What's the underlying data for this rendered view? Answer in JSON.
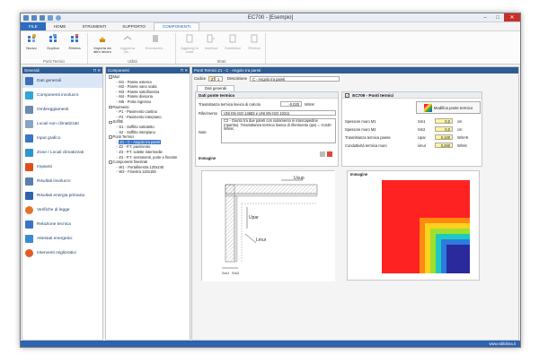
{
  "window": {
    "title": "EC700 - [Esempio]"
  },
  "menu_tabs": [
    {
      "label": "FILE"
    },
    {
      "label": "HOME"
    },
    {
      "label": "STRUMENTI"
    },
    {
      "label": "SUPPORTO"
    },
    {
      "label": "COMPONENTI"
    }
  ],
  "ribbon": {
    "group1_label": "Ponti Termici",
    "group2_label": "Utilità",
    "group3_label": "Strati",
    "buttons": {
      "nuovo": "Nuovo",
      "duplica": "Duplica",
      "elimina": "Elimina",
      "importa": "Importa da altro lavoro",
      "aggiorna": "Aggiorna da...",
      "sovrascrivi": "Sovrascrivi...",
      "aggiungi": "Aggiungi in coda",
      "inserisci": "Inserisci",
      "sostituisci": "Sostituisci",
      "elimina_strato": "Elimina"
    }
  },
  "generali_panel": {
    "title": "Generali",
    "items": [
      {
        "label": "Dati generali"
      },
      {
        "label": "Componenti involucro"
      },
      {
        "label": "Ombreggiamenti"
      },
      {
        "label": "Locali non climatizzati"
      },
      {
        "label": "Input grafico"
      },
      {
        "label": "Zone / Locali climatizzati"
      },
      {
        "label": "Impianti"
      },
      {
        "label": "Risultati involucro"
      },
      {
        "label": "Risultati energia primaria"
      },
      {
        "label": "Verifiche di legge"
      },
      {
        "label": "Relazione tecnica"
      },
      {
        "label": "Attestati energetici"
      },
      {
        "label": "Interventi migliorativi"
      }
    ]
  },
  "componenti_panel": {
    "title": "Componenti",
    "tree": [
      {
        "level": 1,
        "label": "Muri"
      },
      {
        "level": 2,
        "label": "M1 - Parete esterna"
      },
      {
        "level": 2,
        "label": "M2 - Parete vano scala"
      },
      {
        "level": 2,
        "label": "M3 - Parete sottofinestra"
      },
      {
        "level": 2,
        "label": "M4 - Parete divisoria"
      },
      {
        "level": 2,
        "label": "M5 - Porta ingresso"
      },
      {
        "level": 1,
        "label": "Pavimenti"
      },
      {
        "level": 2,
        "label": "P1 - Pavimento cantina"
      },
      {
        "level": 2,
        "label": "P2 - Pavimento interpiano"
      },
      {
        "level": 1,
        "label": "Soffitti"
      },
      {
        "level": 2,
        "label": "S1 - Soffitto sottotetto"
      },
      {
        "level": 2,
        "label": "S2 - Soffitto interpiano"
      },
      {
        "level": 1,
        "label": "Ponti Termici"
      },
      {
        "level": 2,
        "label": "Z1 - C - Angolo tra pareti",
        "selected": true
      },
      {
        "level": 2,
        "label": "Z2 - P.T. pavimento"
      },
      {
        "level": 2,
        "label": "Z3 - P.T. solette intermedie"
      },
      {
        "level": 2,
        "label": "Z4 - P.T. serramenti, porte e finestre"
      },
      {
        "level": 1,
        "label": "Componenti finestrati"
      },
      {
        "level": 2,
        "label": "W1 - Portafinestra 120x240"
      },
      {
        "level": 2,
        "label": "W2 - Finestra 120x150"
      }
    ]
  },
  "main_panel": {
    "title": "Ponti Termici Z1 - C - Angolo tra pareti",
    "codice_label": "Codice",
    "codice_prefix": "Z",
    "codice_value": "1",
    "descrizione_label": "Descrizione",
    "descrizione_value": "C - Angolo tra pareti",
    "subtab": "Dati generali",
    "ponte": {
      "title": "Dati ponte termico",
      "trasm_label": "Trasmittanza termica lineica di calcolo",
      "trasm_value": "-0,020",
      "trasm_unit": "W/mK",
      "rif_label": "Riferimento",
      "rif_value": "UNI EN ISO 14683 e UNI EN ISO 10211",
      "note_label": "Note",
      "note_value": "C2 - Giunto tra due pareti con isolamento in intercapedine (ripartito). Trasmittanza termica lineica di riferimento (ψe) = -0,040 W/mK."
    },
    "immagine_title": "Immagine",
    "ec709": {
      "title": "EC709 - Ponti termici",
      "button": "Modifica ponte termico",
      "rows": [
        {
          "label": "Spessore muro M1",
          "sym": "Sm1",
          "value": "0,0",
          "unit": "cm"
        },
        {
          "label": "Spessore muro M2",
          "sym": "Sm2",
          "value": "0,0",
          "unit": "cm"
        },
        {
          "label": "Trasmittanza termica parete",
          "sym": "Upar",
          "value": "0,100",
          "unit": "W/m²K"
        },
        {
          "label": "Conduttività termica muro",
          "sym": "λmur",
          "value": "0,250",
          "unit": "W/mK"
        }
      ]
    },
    "drawing_labels": {
      "u1": "Usup",
      "u2": "Upar",
      "u3": "Lmur",
      "s1": "Sm1",
      "s2": "Sm2"
    }
  },
  "status": {
    "url": "www.edilclima.it"
  },
  "colors": {
    "accent": "#2d6cc0",
    "header": "#2e5d95",
    "status": "#2c63b3"
  }
}
